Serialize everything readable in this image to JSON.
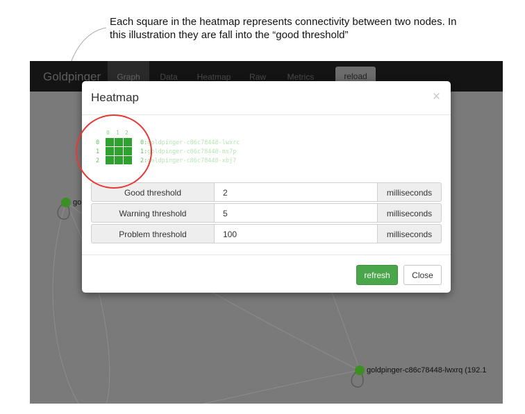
{
  "annotation": {
    "text": "Each square in the heatmap represents connectivity between two nodes. In this illustration they are fall into the “good threshold”"
  },
  "navbar": {
    "brand": "Goldpinger",
    "items": [
      {
        "label": "Graph",
        "active": true
      },
      {
        "label": "Data",
        "active": false
      },
      {
        "label": "Heatmap",
        "active": false
      },
      {
        "label": "Raw",
        "active": false
      },
      {
        "label": "Metrics",
        "active": false
      }
    ],
    "reload_label": "reload"
  },
  "graph": {
    "nodes": [
      {
        "label": "go",
        "color": "#3c8f22"
      },
      {
        "label": "goldpinger-c86c78448-lwxrq (192.1",
        "color": "#3c8f22"
      }
    ]
  },
  "modal": {
    "title": "Heatmap",
    "close_glyph": "×",
    "heatmap": {
      "column_numbers": [
        "0",
        "1",
        "2"
      ],
      "row_numbers": [
        "0",
        "1",
        "2"
      ],
      "cell_color": "#2fa12f",
      "nodes": [
        {
          "index": "0:",
          "name": "goldpinger-c86c78448-lwxrc"
        },
        {
          "index": "1:",
          "name": "goldpinger-c86c78448-ms7p"
        },
        {
          "index": "2:",
          "name": "goldpinger-c86c78448-xbj7"
        }
      ]
    },
    "thresholds": [
      {
        "label": "Good threshold",
        "value": "2",
        "unit": "milliseconds"
      },
      {
        "label": "Warning threshold",
        "value": "5",
        "unit": "milliseconds"
      },
      {
        "label": "Problem threshold",
        "value": "100",
        "unit": "milliseconds"
      }
    ],
    "buttons": {
      "refresh": "refresh",
      "close": "Close"
    }
  },
  "colors": {
    "highlight_circle": "#e53935",
    "success_button": "#4aa64a",
    "node_green": "#3c8f22"
  }
}
